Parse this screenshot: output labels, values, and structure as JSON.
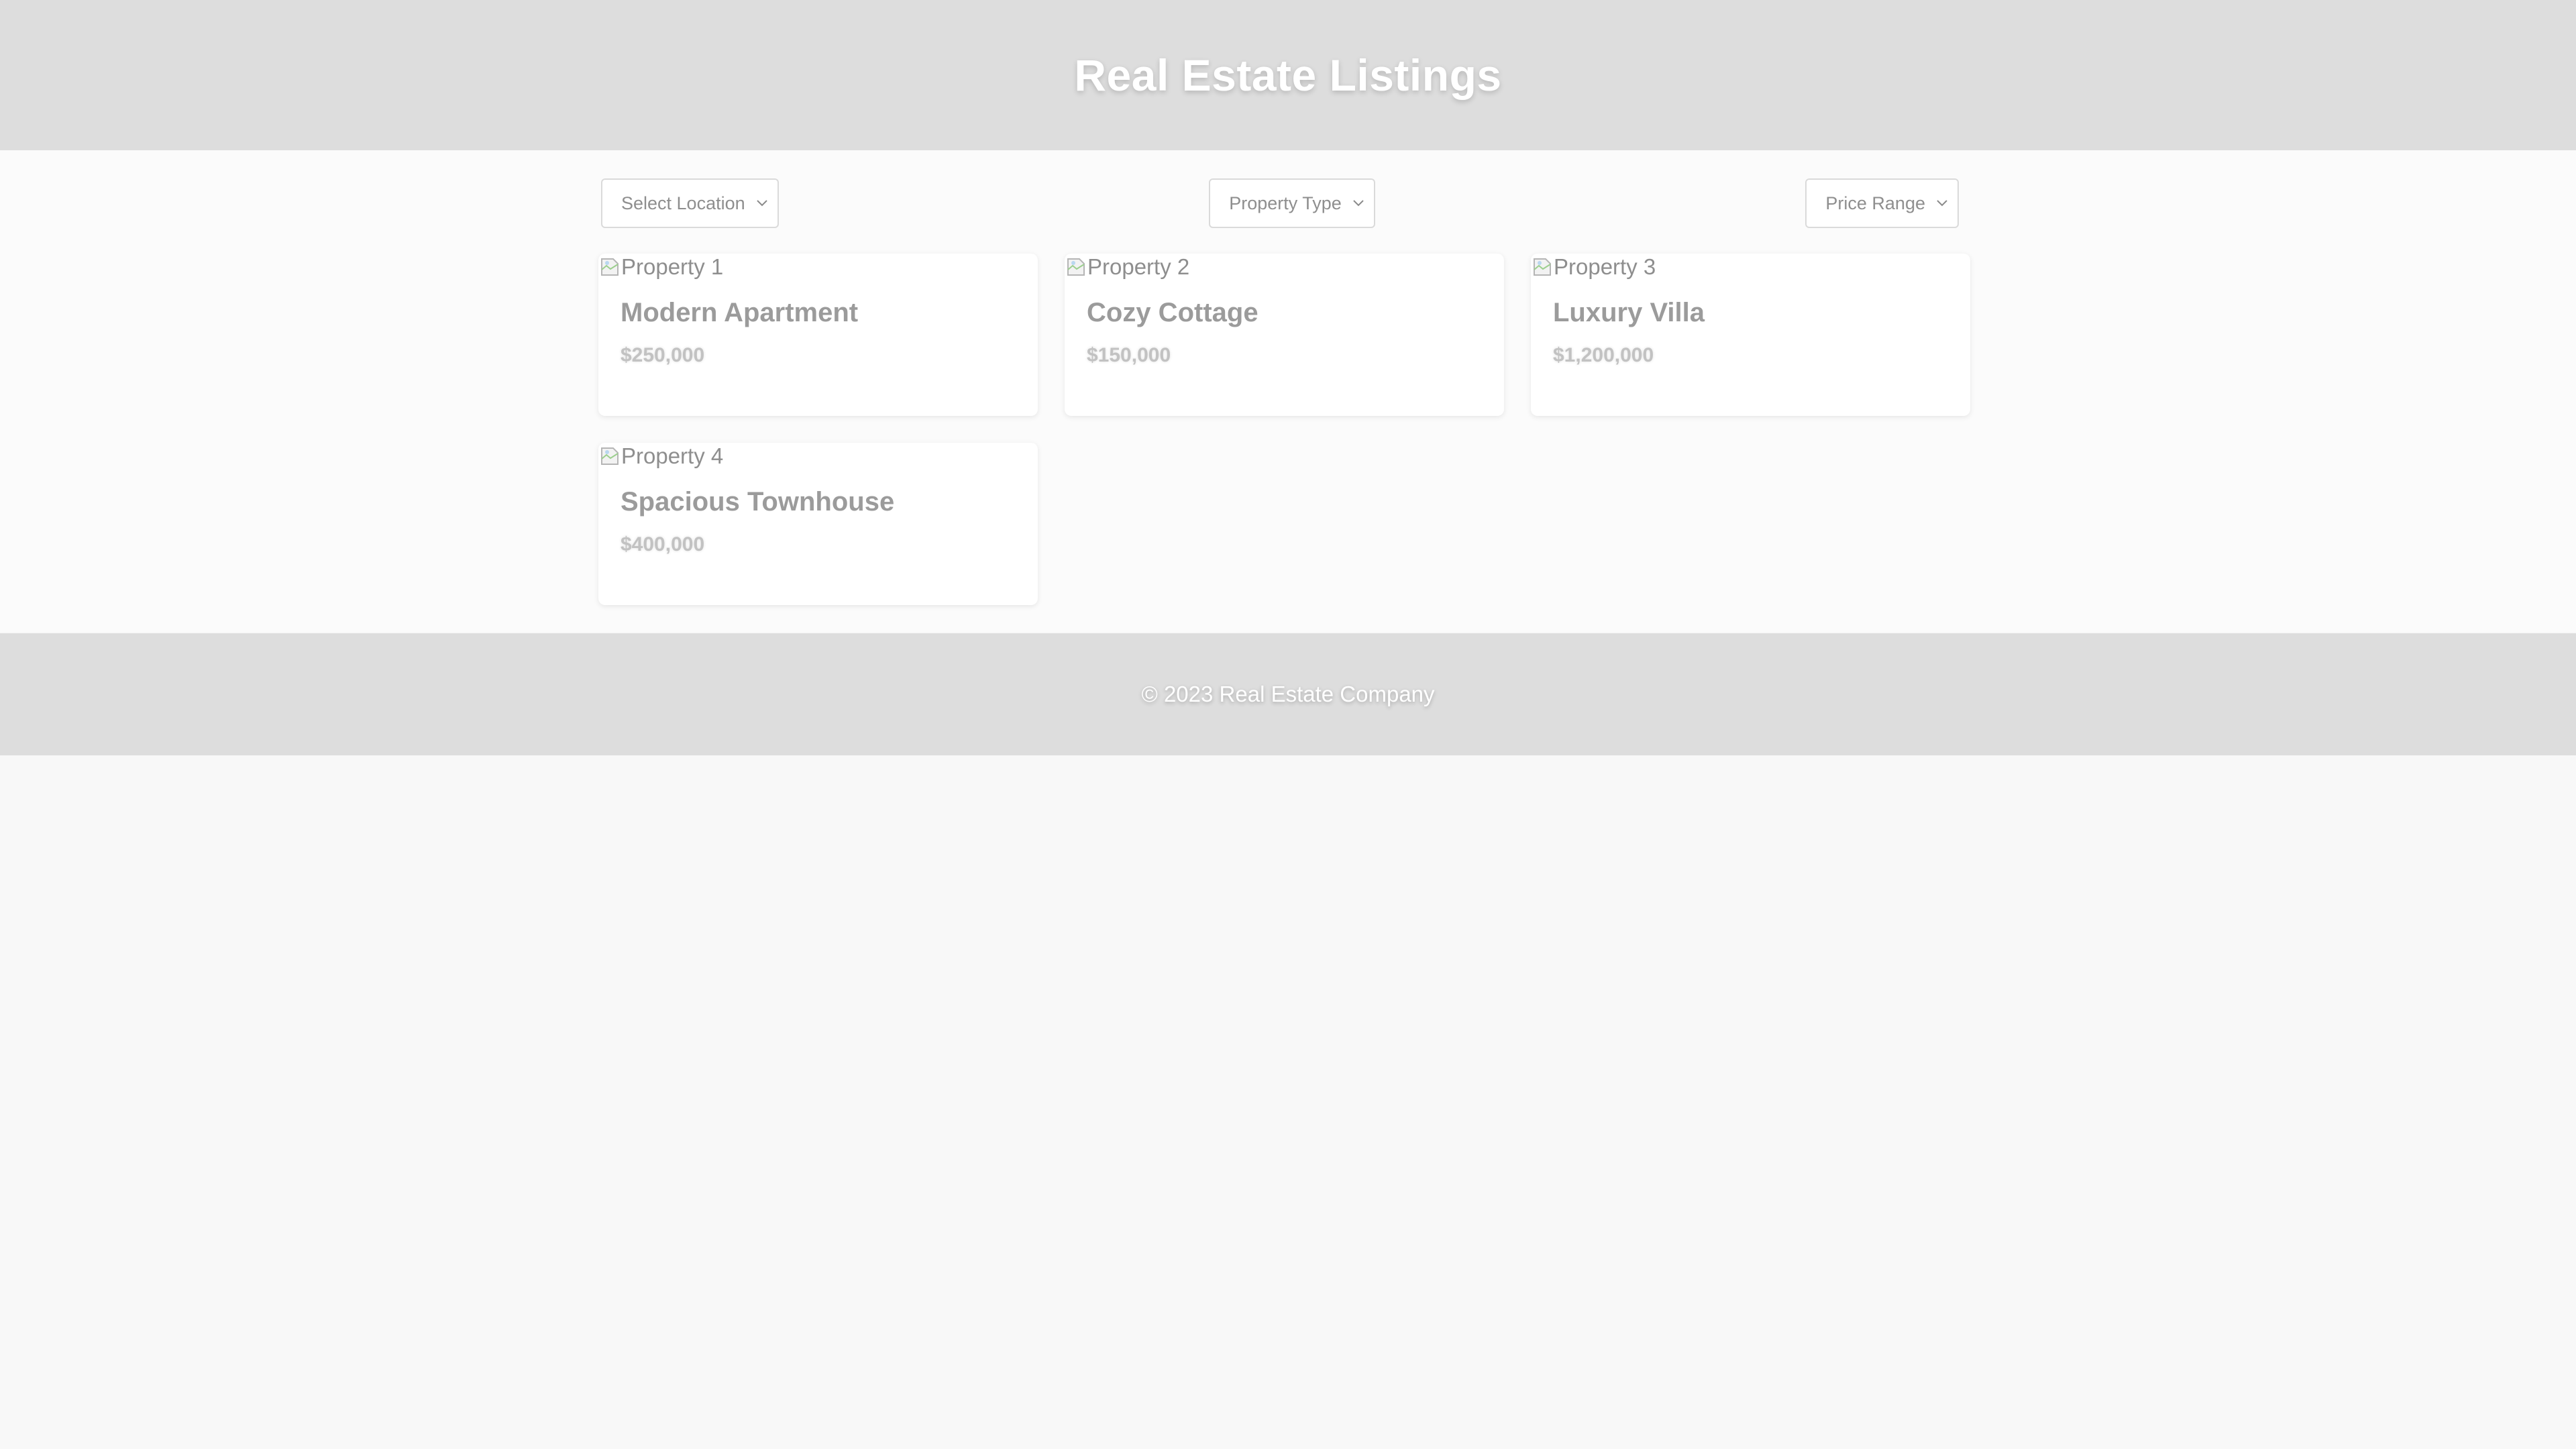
{
  "header": {
    "title": "Real Estate Listings"
  },
  "filters": {
    "location": "Select Location",
    "type": "Property Type",
    "price": "Price Range"
  },
  "listings": [
    {
      "image_alt": "Property 1",
      "title": "Modern Apartment",
      "price": "$250,000"
    },
    {
      "image_alt": "Property 2",
      "title": "Cozy Cottage",
      "price": "$150,000"
    },
    {
      "image_alt": "Property 3",
      "title": "Luxury Villa",
      "price": "$1,200,000"
    },
    {
      "image_alt": "Property 4",
      "title": "Spacious Townhouse",
      "price": "$400,000"
    }
  ],
  "footer": {
    "text": "© 2023 Real Estate Company"
  },
  "icons": {
    "broken_image": "broken-image-icon",
    "dropdown": "chevron-down-icon"
  },
  "colors": {
    "header_bg": "#dddddd",
    "page_bg": "#fbfbfb",
    "card_bg": "#ffffff"
  }
}
